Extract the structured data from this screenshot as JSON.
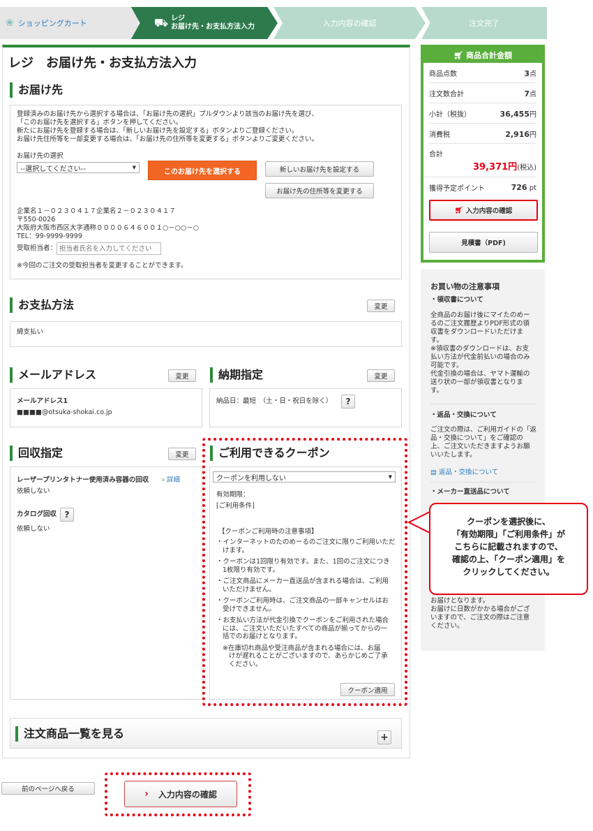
{
  "steps": {
    "s1": "ショッピングカート",
    "s2a": "レジ",
    "s2b": "お届け先・お支払方法入力",
    "s3": "入力内容の確認",
    "s4": "注文完了"
  },
  "title": "レジ　お届け先・お支払方法入力",
  "delivery": {
    "heading": "お届け先",
    "desc1": "登録済みのお届け先から選択する場合は、「お届け先の選択」プルダウンより該当のお届け先を選び、",
    "desc2": "「このお届け先を選択する」ボタンを押してください。",
    "desc3": "新たにお届け先を登録する場合は、「新しいお届け先を設定する」ボタンよりご登録ください。",
    "desc4": "お届け先住所等を一部変更する場合は、「お届け先の住所等を変更する」ボタンよりご変更ください。",
    "select_label": "お届け先の選択",
    "select_value": "--選択してください--",
    "select_btn": "このお届け先を選択する",
    "new_btn": "新しいお届け先を設定する",
    "change_btn": "お届け先の住所等を変更する",
    "addr1": "企業名１－０２３０４１７企業名２－０２３０４１７",
    "addr2": "〒550-0026",
    "addr3": "大阪府大阪市西区大字通称００００６４６００１○－○○－○",
    "addr4": "TEL：99-9999-9999",
    "receiver_label": "受取担当者：",
    "receiver_placeholder": "担当者氏名を入力してください",
    "receiver_note": "※今回のご注文の受取担当者を変更することができます。"
  },
  "payment": {
    "heading": "お支払方法",
    "change": "変更",
    "value": "締支払い"
  },
  "mail": {
    "heading": "メールアドレス",
    "change": "変更",
    "label": "メールアドレス1",
    "value": "■■■■@otsuka-shokai.co.jp"
  },
  "delivery_date": {
    "heading": "納期指定",
    "change": "変更",
    "value": "納品日：最短　（土・日・祝日を除く）",
    "help": "?"
  },
  "collect": {
    "heading": "回収指定",
    "change": "変更",
    "item1": "レーザープリンタトナー使用済み容器の回収",
    "detail": "詳細",
    "item1_val": "依頼しない",
    "item2": "カタログ回収",
    "help": "?",
    "item2_val": "依頼しない"
  },
  "coupon": {
    "heading": "ご利用できるクーポン",
    "select": "クーポンを利用しない",
    "expiry": "有効期限：",
    "cond": "[ご利用条件]",
    "notes_title": "【クーポンご利用時の注意事項】",
    "n1a": "・インターネットのたのめーるのご注文に限りご利用いただ",
    "n1b": "けます。",
    "n2a": "・クーポンは1回限り有効です。また、1回のご注文につき",
    "n2b": "1枚限り有効です。",
    "n3a": "・ご注文商品にメーカー直送品が含まれる場合は、ご利用",
    "n3b": "いただけません。",
    "n4a": "・クーポンご利用時は、ご注文商品の一部キャンセルはお",
    "n4b": "受けできません。",
    "n5a": "・お支払い方法が代金引換でクーポンをご利用された場合",
    "n5b": "には、ご注文いただいたすべての商品が揃ってからの一",
    "n5c": "括でのお届けとなります。",
    "n6a": "※在庫切れ商品や受注商品が含まれる場合には、お届",
    "n6b": "けが遅れることがございますので、あらかじめご了承",
    "n6c": "ください。",
    "apply": "クーポン適用"
  },
  "items": {
    "heading": "注文商品一覧を見る",
    "plus": "+"
  },
  "back_btn": "前のページへ戻る",
  "confirm_btn": "入力内容の確認",
  "summary": {
    "heading": "商品合計金額",
    "qty_label": "商品点数",
    "qty": "3",
    "qty_unit": "点",
    "ord_label": "注文数合計",
    "ord": "7",
    "ord_unit": "点",
    "sub_label": "小計（税抜）",
    "sub": "36,455",
    "yen": "円",
    "tax_label": "消費税",
    "tax": "2,916",
    "total_label": "合計",
    "total": "39,371円",
    "incl": "(税込)",
    "pt_label": "獲得予定ポイント",
    "pt": "726",
    "pt_unit": "pt",
    "confirm": "入力内容の確認",
    "pdf": "見積書（PDF)"
  },
  "notice": {
    "heading": "お買い物の注意事項",
    "sub1": "・領収書について",
    "p1a": "全商品のお届け後にマイたのめー",
    "p1b": "るのご注文履歴よりPDF形式の領",
    "p1c": "収書をダウンロードいただけま",
    "p1d": "す。",
    "p2a": "※領収書のダウンロードは、お支",
    "p2b": "払い方法が代金前払いの場合のみ",
    "p2c": "可能です。",
    "p3a": "代金引換の場合は、ヤマト運輸の",
    "p3b": "送り状の一部が領収書となりま",
    "p3c": "す。",
    "sub2": "・返品・交換について",
    "p4a": "ご注文の際は、ご利用ガイドの「返",
    "p4b": "品・交換について」をご確認の",
    "p4c": "上、ご注文いただきますようお願",
    "p4d": "いいたします。",
    "link": "返品・交換について",
    "sub3": "・メーカー直送品について",
    "p5a": "お届けとなります。",
    "p5b": "お届けに日数がかかる場合がござ",
    "p5c": "いますので、ご注文の際はご注意",
    "p5d": "ください。"
  },
  "callout": {
    "l1": "クーポンを選択後に、",
    "l2": "「有効期限」「ご利用条件」が",
    "l3": "こちらに記載されますので、",
    "l4": "確認の上、「クーポン適用」を",
    "l5": "クリックしてください。"
  }
}
